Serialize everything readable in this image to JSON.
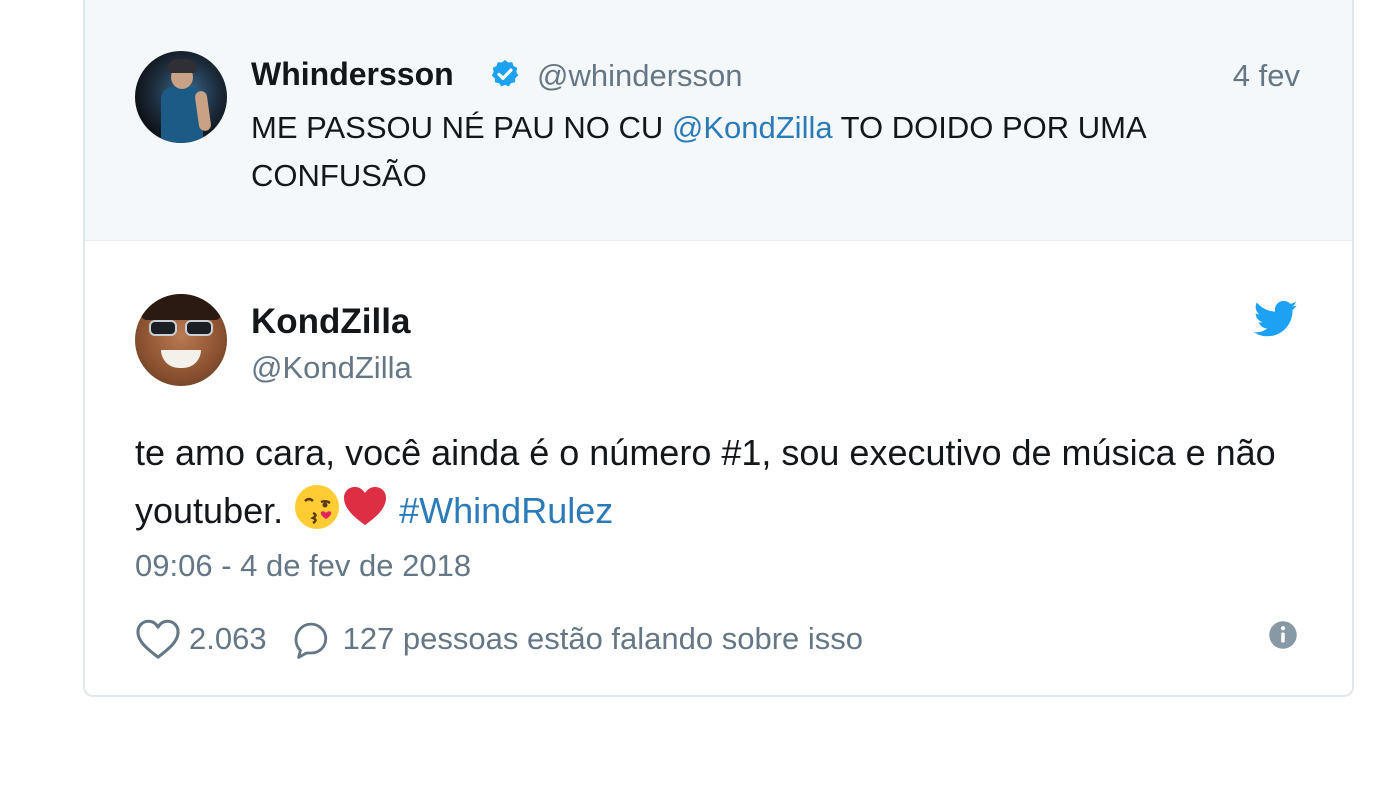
{
  "quoted_tweet": {
    "author_name": "Whindersson",
    "verified_icon": "verified-badge-icon",
    "author_handle": "@whindersson",
    "date": "4 fev",
    "text_before": "ME PASSOU NÉ PAU NO CU ",
    "mention": "@KondZilla",
    "text_after": " TO DOIDO POR UMA CONFUSÃO"
  },
  "tweet": {
    "author_name": "KondZilla",
    "author_handle": "@KondZilla",
    "text_line": "te amo cara, você ainda é o número #1, sou executivo de música e não youtuber. ",
    "emojis": [
      "kissing-face-icon",
      "red-heart-icon"
    ],
    "hashtag": "#WhindRulez",
    "timestamp": "09:06 - 4 de fev de 2018",
    "like_count": "2.063",
    "reply_text": "127 pessoas estão falando sobre isso"
  },
  "colors": {
    "link": "#2b7bb9",
    "muted": "#657786",
    "quoted_bg": "#f5f8fa",
    "twitter_blue": "#1da1f2"
  }
}
